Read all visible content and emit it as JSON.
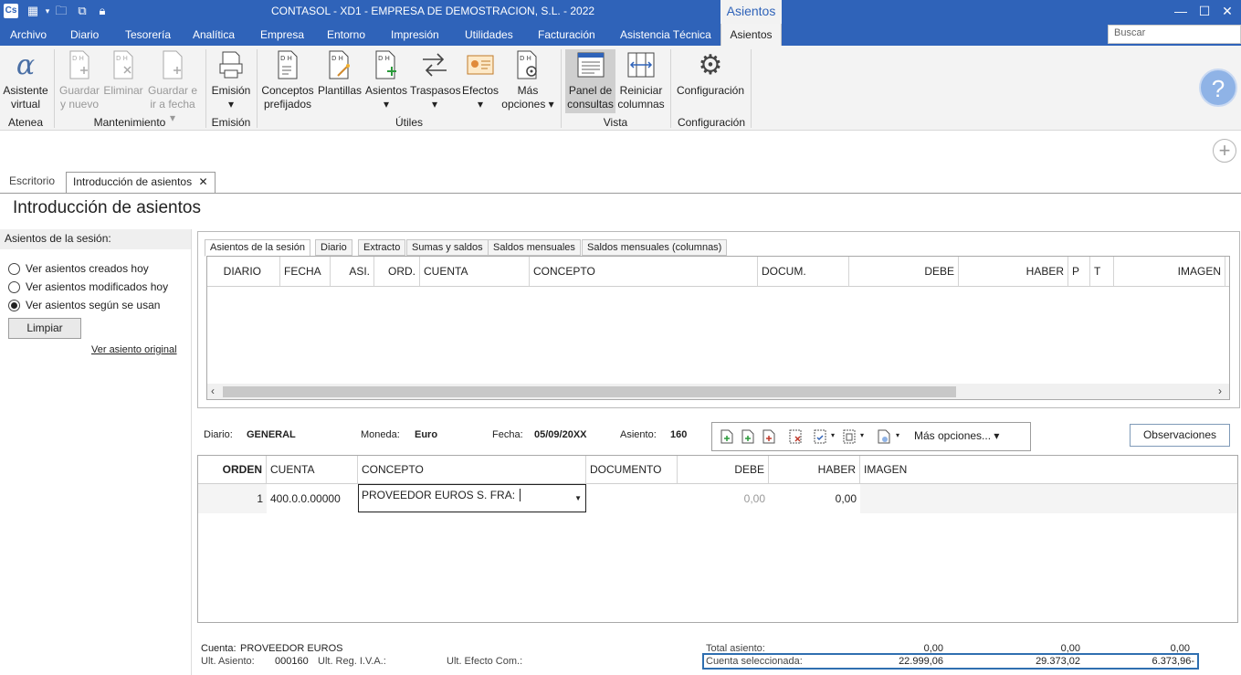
{
  "window": {
    "title": "CONTASOL - XD1 - EMPRESA DE DEMOSTRACION, S.L. - 2022",
    "context_tab": "Asientos",
    "app_badge": "Cs"
  },
  "menu": {
    "items": [
      "Archivo",
      "Diario",
      "Tesorería",
      "Analítica",
      "Empresa",
      "Entorno",
      "Impresión",
      "Utilidades",
      "Facturación",
      "Asistencia Técnica"
    ],
    "active": "Asientos",
    "search_placeholder": "Buscar"
  },
  "ribbon": {
    "asistente": [
      "Asistente",
      "virtual"
    ],
    "guardar_nuevo": [
      "Guardar",
      "y nuevo"
    ],
    "eliminar": [
      "Eliminar",
      ""
    ],
    "guardar_fecha": [
      "Guardar e",
      "ir a fecha ▾"
    ],
    "emision_btn": [
      "Emisión",
      "▾"
    ],
    "conceptos": [
      "Conceptos",
      "prefijados"
    ],
    "plantillas": [
      "Plantillas",
      ""
    ],
    "asientos": [
      "Asientos",
      "▾"
    ],
    "traspasos": [
      "Traspasos",
      "▾"
    ],
    "efectos": [
      "Efectos",
      "▾"
    ],
    "mas_opciones": [
      "Más",
      "opciones ▾"
    ],
    "panel": [
      "Panel de",
      "consultas"
    ],
    "reiniciar": [
      "Reiniciar",
      "columnas"
    ],
    "configuracion_btn": [
      "Configuración",
      ""
    ],
    "groups": {
      "atenea": "Atenea",
      "mantenimiento": "Mantenimiento",
      "emision": "Emisión",
      "utiles": "Útiles",
      "vista": "Vista",
      "configuracion": "Configuración"
    },
    "dh": "D H"
  },
  "tabs": {
    "escritorio": "Escritorio",
    "intro": "Introducción de asientos"
  },
  "page_title": "Introducción de asientos",
  "left": {
    "header": "Asientos de la sesión:",
    "radios": [
      "Ver asientos creados hoy",
      "Ver asientos modificados hoy",
      "Ver asientos según se usan"
    ],
    "selected_radio": 2,
    "limpiar": "Limpiar",
    "ver_original": "Ver asiento original"
  },
  "upper": {
    "tabs": [
      "Asientos de la sesión",
      "Diario",
      "Extracto",
      "Sumas y saldos",
      "Saldos mensuales",
      "Saldos mensuales (columnas)"
    ],
    "columns": [
      "DIARIO",
      "FECHA",
      "ASI.",
      "ORD.",
      "CUENTA",
      "CONCEPTO",
      "DOCUM.",
      "DEBE",
      "HABER",
      "P",
      "T",
      "IMAGEN"
    ]
  },
  "info": {
    "diario_label": "Diario:",
    "diario_value": "GENERAL",
    "moneda_label": "Moneda:",
    "moneda_value": "Euro",
    "fecha_label": "Fecha:",
    "fecha_value": "05/09/20XX",
    "asiento_label": "Asiento:",
    "asiento_value": "160",
    "mas_opciones": "Más opciones... ▾",
    "observaciones": "Observaciones"
  },
  "lower": {
    "columns": [
      "ORDEN",
      "CUENTA",
      "CONCEPTO",
      "DOCUMENTO",
      "DEBE",
      "HABER",
      "IMAGEN"
    ],
    "row": {
      "orden": "1",
      "cuenta": "400.0.0.00000",
      "concepto": "PROVEEDOR EUROS S. FRA:",
      "documento": "",
      "debe": "0,00",
      "haber": "0,00"
    }
  },
  "footer": {
    "cuenta_label": "Cuenta:",
    "cuenta_value": "PROVEEDOR EUROS",
    "ult_asiento_label": "Ult. Asiento:",
    "ult_asiento_value": "000160",
    "ult_iva_label": "Ult. Reg. I.V.A.:",
    "ult_efecto_label": "Ult. Efecto Com.:",
    "total_label": "Total asiento:",
    "total_debe": "0,00",
    "total_haber": "0,00",
    "total_saldo": "0,00",
    "sel_label": "Cuenta seleccionada:",
    "sel_debe": "22.999,06",
    "sel_haber": "29.373,02",
    "sel_saldo": "6.373,96-"
  }
}
